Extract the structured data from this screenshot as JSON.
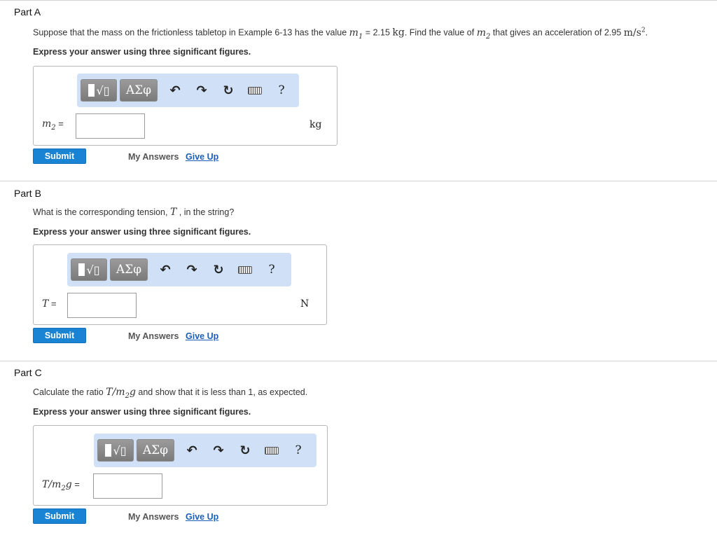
{
  "partA": {
    "title": "Part A",
    "q_prefix": "Suppose that the mass on the frictionless tabletop in Example 6-13 has the value ",
    "q_m1": "m",
    "q_m1_sub": "1",
    "q_eq_value": " = 2.15 ",
    "q_unit_kg": "kg",
    "q_mid": ". Find the value of ",
    "q_m2": "m",
    "q_m2_sub": "2",
    "q_suffix": " that gives an acceleration of 2.95 ",
    "q_accel_unit": "m/s",
    "q_accel_sup": "2",
    "q_end": ".",
    "instruction": "Express your answer using three significant figures.",
    "var_label": "m",
    "var_sub": "2",
    "var_eq": " =",
    "input_value": "",
    "unit": "kg"
  },
  "partB": {
    "title": "Part B",
    "q_prefix": "What is the corresponding tension, ",
    "q_var": "T",
    "q_suffix": " , in the string?",
    "instruction": "Express your answer using three significant figures.",
    "var_label": "T",
    "var_eq": " =",
    "input_value": "",
    "unit": "N"
  },
  "partC": {
    "title": "Part C",
    "q_prefix": "Calculate the ratio ",
    "q_ratio": "T/m",
    "q_ratio_sub": "2",
    "q_ratio_g": "g",
    "q_suffix": " and show that it is less than 1, as expected.",
    "instruction": "Express your answer using three significant figures.",
    "var_label": "T/m",
    "var_sub": "2",
    "var_g": "g",
    "var_eq": " =",
    "input_value": ""
  },
  "toolbar": {
    "greek_label": "ΑΣφ",
    "radical_label": "√▯",
    "undo_glyph": "↶",
    "redo_glyph": "↷",
    "reset_glyph": "↻",
    "help_label": "?"
  },
  "actions": {
    "submit_label": "Submit",
    "my_answers_label": "My Answers",
    "give_up_label": "Give Up"
  },
  "colors": {
    "submit_bg": "#1a84d4",
    "toolbar_bg": "#cfe0f7",
    "link": "#1a5fb4"
  }
}
